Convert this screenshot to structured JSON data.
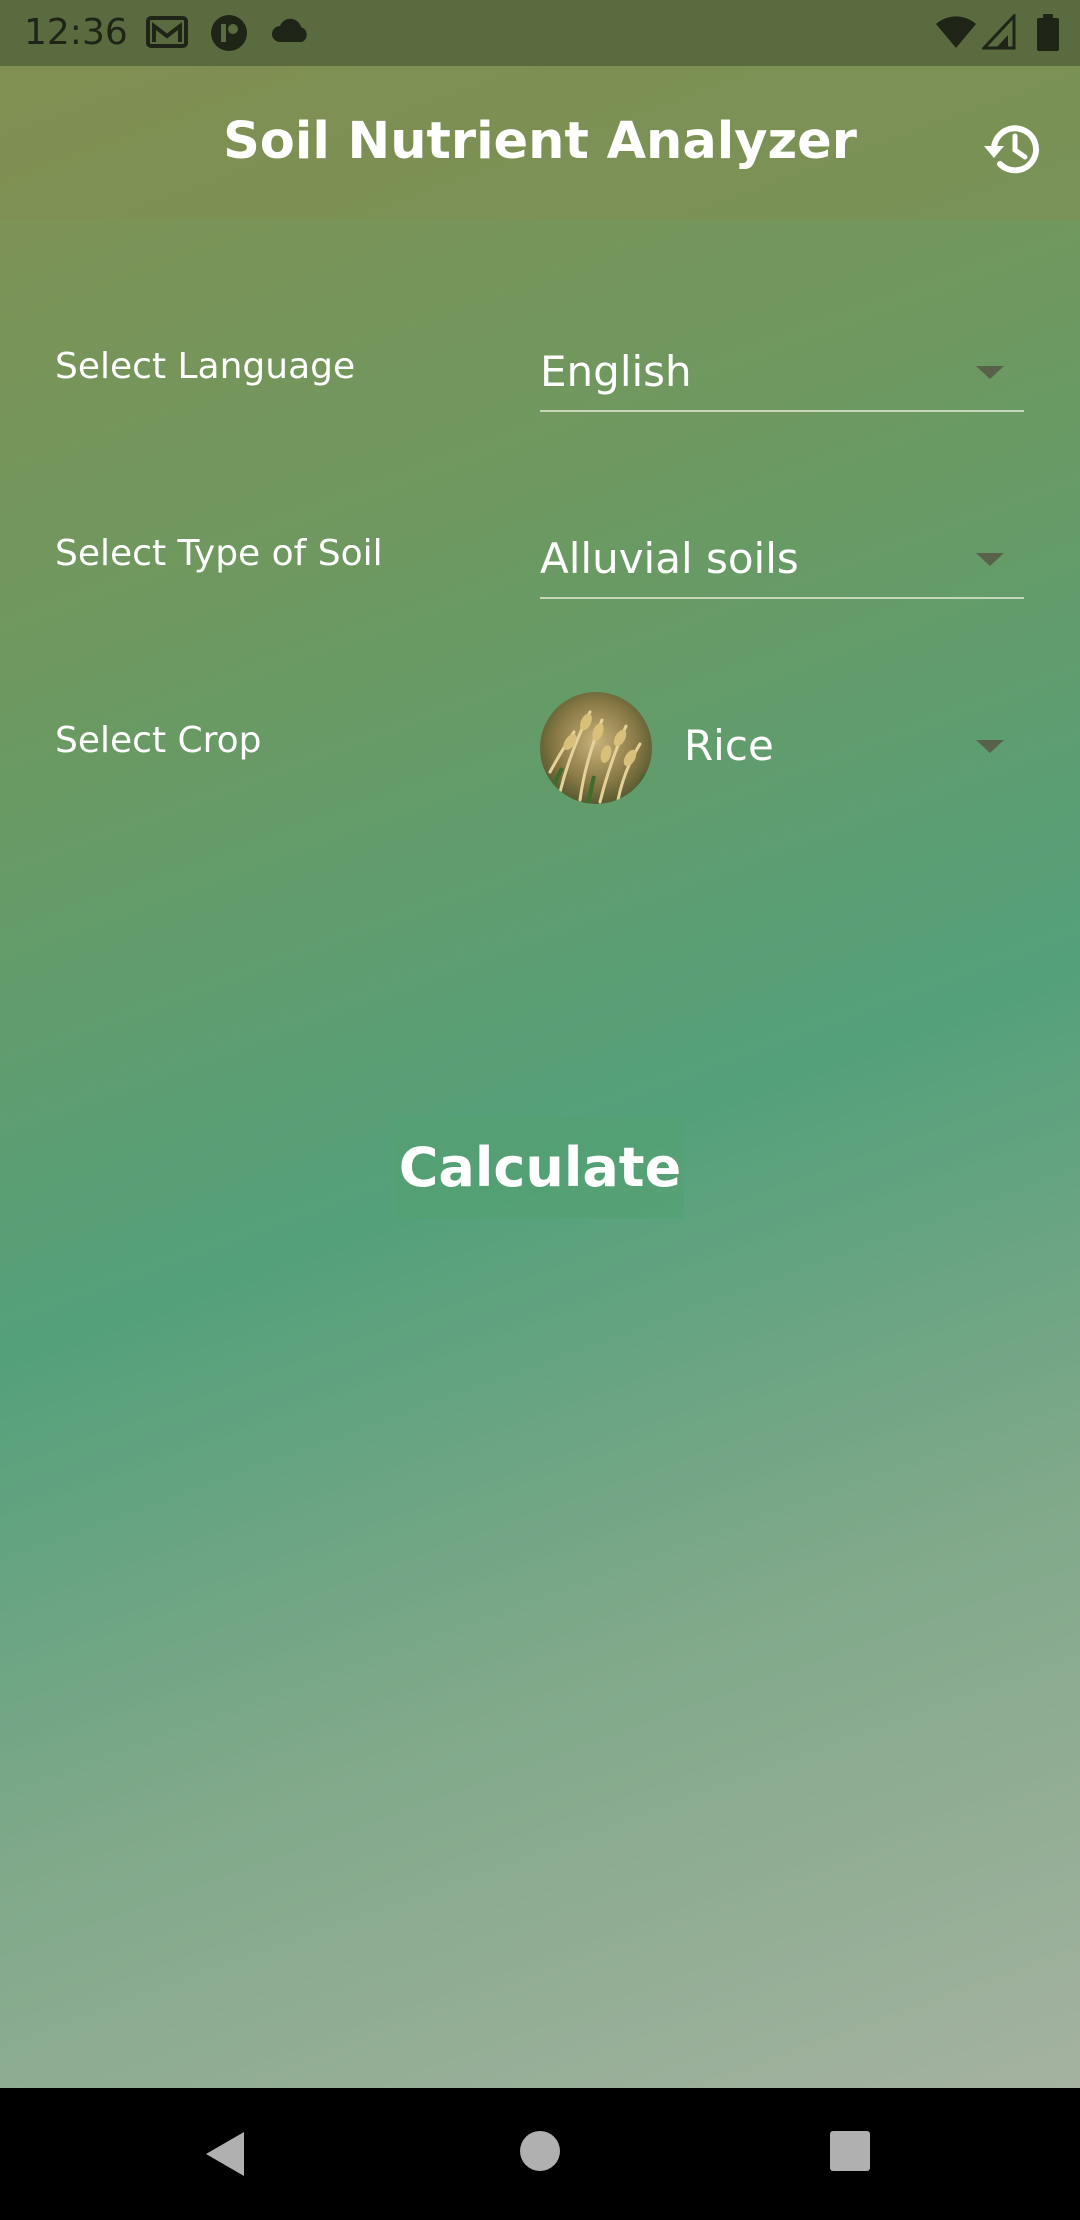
{
  "status_bar": {
    "time": "12:36",
    "icons": [
      "gmail-icon",
      "app-notification-icon",
      "cloud-icon",
      "wifi-icon",
      "cell-signal-icon",
      "battery-icon"
    ]
  },
  "app_bar": {
    "title": "Soil Nutrient Analyzer",
    "history_icon": "history-icon"
  },
  "form": {
    "language": {
      "label": "Select Language",
      "value": "English"
    },
    "soil": {
      "label": "Select Type of Soil",
      "value": "Alluvial soils"
    },
    "crop": {
      "label": "Select Crop",
      "value": "Rice",
      "image": "rice-crop-image"
    }
  },
  "actions": {
    "calculate_label": "Calculate"
  },
  "nav_bar": {
    "icons": [
      "back-icon",
      "home-icon",
      "recents-icon"
    ]
  },
  "colors": {
    "gradient_top": "#848f51",
    "gradient_mid": "#54a07b",
    "gradient_bottom": "#acb4a4",
    "status_bar_bg": "#5a6b40",
    "button_bg": "#54a073",
    "text": "#ffffff"
  }
}
